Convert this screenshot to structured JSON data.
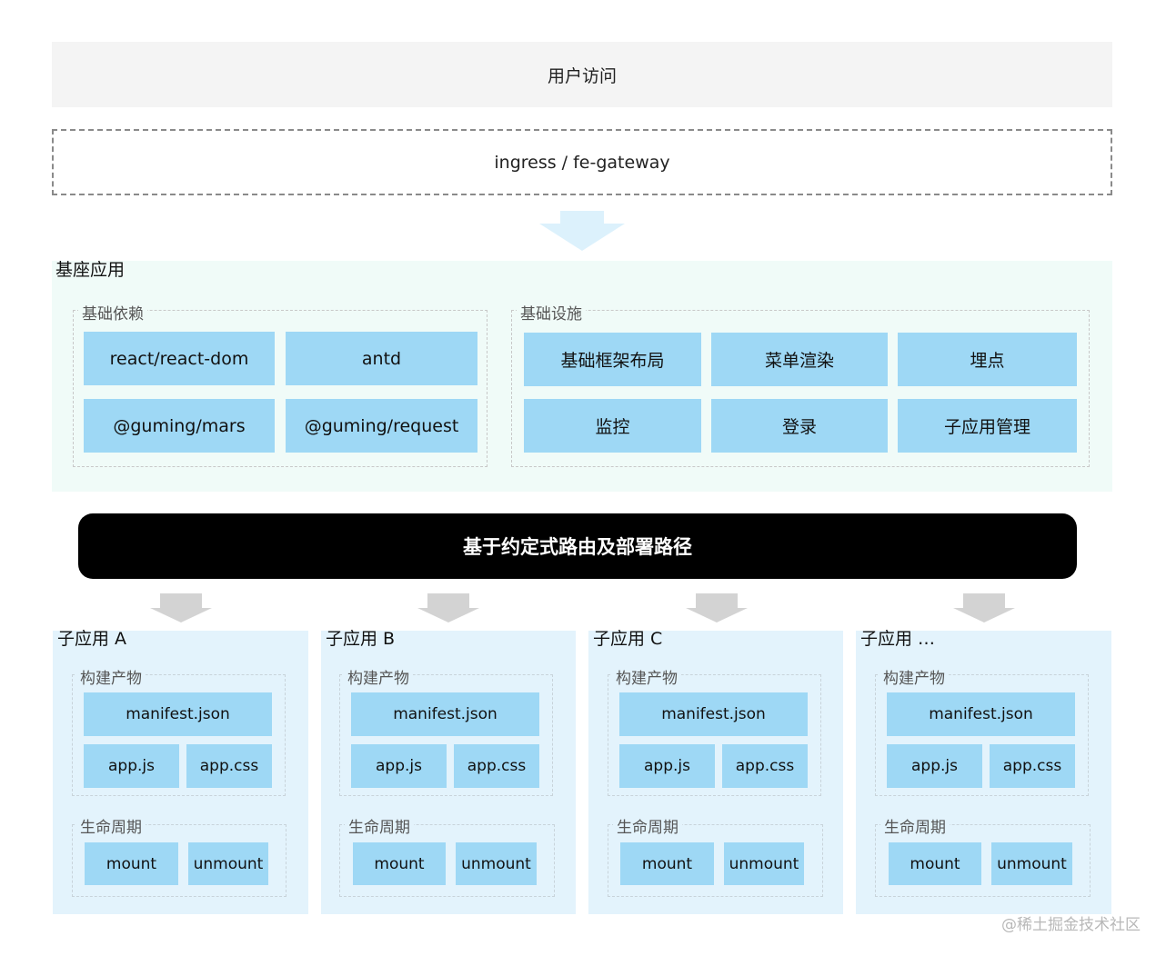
{
  "user_access": "用户访问",
  "gateway": "ingress / fe-gateway",
  "base_app": {
    "title": "基座应用",
    "deps": {
      "label": "基础依赖",
      "items": [
        "react/react-dom",
        "antd",
        "@guming/mars",
        "@guming/request"
      ]
    },
    "infra": {
      "label": "基础设施",
      "items": [
        "基础框架布局",
        "菜单渲染",
        "埋点",
        "监控",
        "登录",
        "子应用管理"
      ]
    }
  },
  "route_bar": "基于约定式路由及部署路径",
  "sub_apps": [
    {
      "title": "子应用 A",
      "build_label": "构建产物",
      "manifest": "manifest.json",
      "js": "app.js",
      "css": "app.css",
      "life_label": "生命周期",
      "mount": "mount",
      "unmount": "unmount"
    },
    {
      "title": "子应用 B",
      "build_label": "构建产物",
      "manifest": "manifest.json",
      "js": "app.js",
      "css": "app.css",
      "life_label": "生命周期",
      "mount": "mount",
      "unmount": "unmount"
    },
    {
      "title": "子应用 C",
      "build_label": "构建产物",
      "manifest": "manifest.json",
      "js": "app.js",
      "css": "app.css",
      "life_label": "生命周期",
      "mount": "mount",
      "unmount": "unmount"
    },
    {
      "title": "子应用 …",
      "build_label": "构建产物",
      "manifest": "manifest.json",
      "js": "app.js",
      "css": "app.css",
      "life_label": "生命周期",
      "mount": "mount",
      "unmount": "unmount"
    }
  ],
  "watermark": "@稀土掘金技术社区"
}
